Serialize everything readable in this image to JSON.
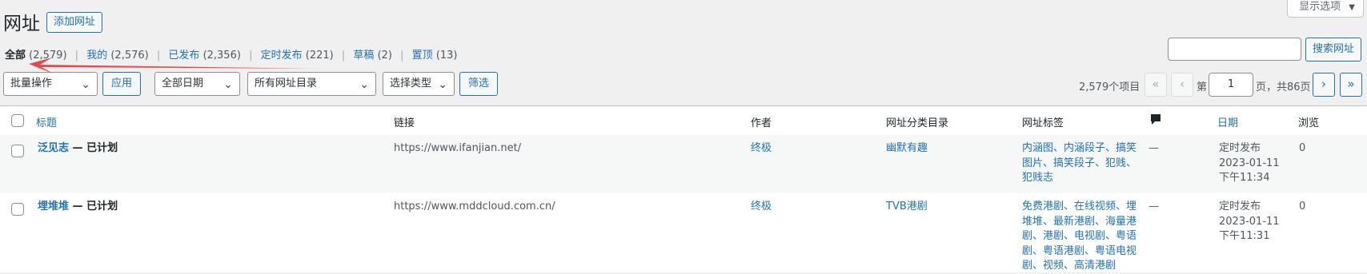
{
  "page": {
    "title": "网址",
    "add_new_label": "添加网址",
    "screen_options_label": "显示选项",
    "screen_options_icon": "caret-down-icon"
  },
  "views": [
    {
      "label": "全部",
      "count": "(2,579)",
      "current": true
    },
    {
      "label": "我的",
      "count": "(2,576)"
    },
    {
      "label": "已发布",
      "count": "(2,356)"
    },
    {
      "label": "定时发布",
      "count": "(221)"
    },
    {
      "label": "草稿",
      "count": "(2)"
    },
    {
      "label": "置顶",
      "count": "(13)"
    }
  ],
  "search": {
    "button_label": "搜索网址",
    "value": ""
  },
  "filters": {
    "bulk_action": "批量操作",
    "apply_label": "应用",
    "date": "全部日期",
    "category": "所有网址目录",
    "type": "选择类型",
    "filter_label": "筛选"
  },
  "pagination": {
    "items_text": "2,579个项目",
    "first": "«",
    "prev": "‹",
    "page_prefix": "第",
    "current_page": "1",
    "page_suffix": "页，共86页",
    "next": "›",
    "last": "»"
  },
  "table": {
    "headers": {
      "title": "标题",
      "link": "链接",
      "author": "作者",
      "category": "网址分类目录",
      "tags": "网址标签",
      "comments_icon": "comment-bubble-icon",
      "date": "日期",
      "views": "浏览"
    },
    "rows": [
      {
        "title": "泛见志",
        "state": " — 已计划",
        "link": "https://www.ifanjian.net/",
        "author": "终极",
        "category": "幽默有趣",
        "tags": "内涵图、内涵段子、搞笑图片、搞笑段子、犯贱、犯贱志",
        "comments": "—",
        "date_status": "定时发布",
        "date_day": "2023-01-11",
        "date_time": "下午11:34",
        "views": "0"
      },
      {
        "title": "埋堆堆",
        "state": " — 已计划",
        "link": "https://www.mddcloud.com.cn/",
        "author": "终极",
        "category": "TVB港剧",
        "tags": "免费港剧、在线视频、埋堆堆、最新港剧、海量港剧、港剧、电视剧、粤语剧、粤语港剧、粤语电视剧、视频、高清港剧",
        "comments": "—",
        "date_status": "定时发布",
        "date_day": "2023-01-11",
        "date_time": "下午11:31",
        "views": "0"
      }
    ]
  },
  "annotation": {
    "arrow_color": "#e5484d"
  }
}
